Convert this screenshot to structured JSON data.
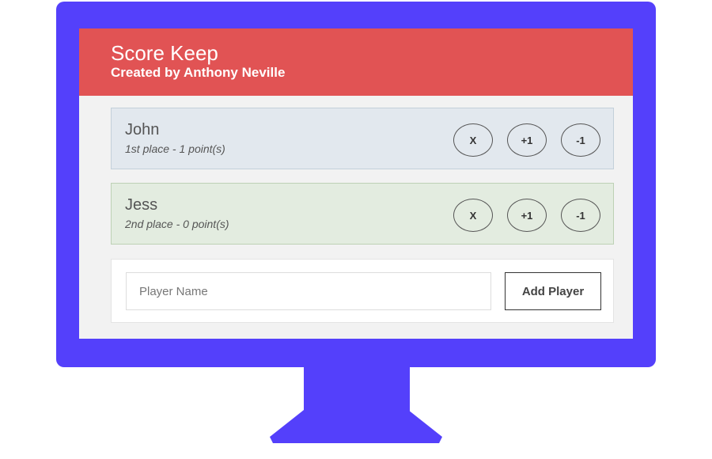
{
  "app": {
    "title": "Score Keep",
    "subtitle": "Created by Anthony Neville"
  },
  "players": [
    {
      "name": "John",
      "rank_text": "1st place - 1 point(s)",
      "remove_label": "X",
      "increment_label": "+1",
      "decrement_label": "-1"
    },
    {
      "name": "Jess",
      "rank_text": "2nd place - 0 point(s)",
      "remove_label": "X",
      "increment_label": "+1",
      "decrement_label": "-1"
    }
  ],
  "add_form": {
    "input_value": "",
    "placeholder": "Player Name",
    "button_label": "Add Player"
  },
  "colors": {
    "monitor": "#5440fb",
    "header": "#e15354",
    "first_place_card": "#e2e8ee",
    "second_place_card": "#e3ece0"
  }
}
